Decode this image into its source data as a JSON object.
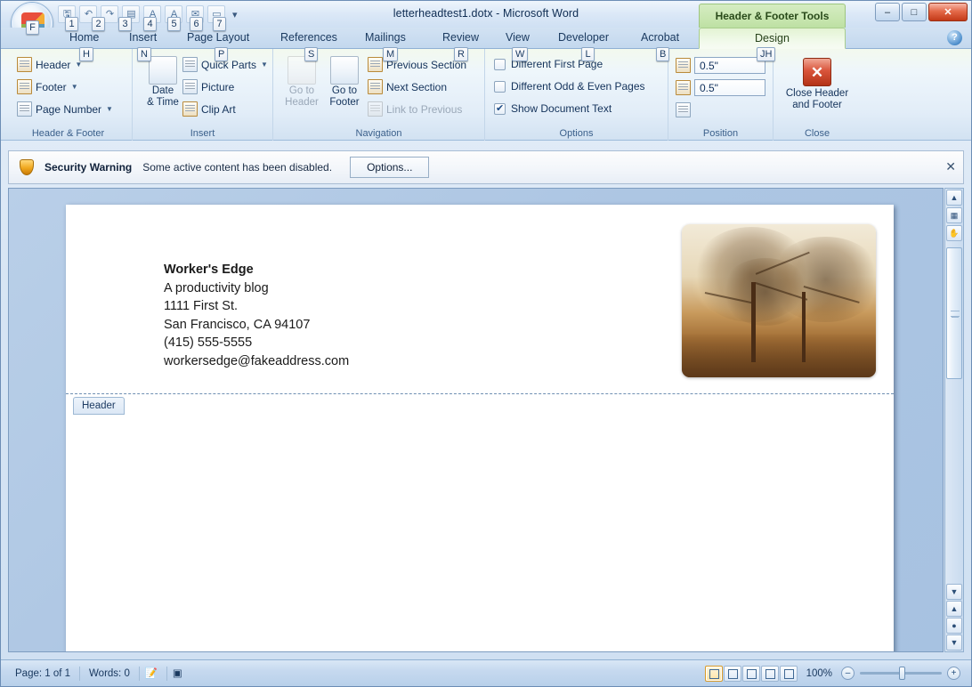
{
  "window": {
    "title": "letterheadtest1.dotx - Microsoft Word",
    "contextual_tab_title": "Header & Footer Tools",
    "minimize_label": "–",
    "maximize_label": "□",
    "close_label": "✕",
    "help_label": "?"
  },
  "office_button": {
    "keytip": "F"
  },
  "quick_access": {
    "keytips": [
      "1",
      "2",
      "3",
      "4",
      "5",
      "6",
      "7"
    ],
    "more_label": "▾"
  },
  "tabs": [
    {
      "label": "Home",
      "keytip": "H",
      "active": false
    },
    {
      "label": "Insert",
      "keytip": "N",
      "active": false
    },
    {
      "label": "Page Layout",
      "keytip": "P",
      "active": false
    },
    {
      "label": "References",
      "keytip": "S",
      "active": false
    },
    {
      "label": "Mailings",
      "keytip": "M",
      "active": false
    },
    {
      "label": "Review",
      "keytip": "R",
      "active": false
    },
    {
      "label": "View",
      "keytip": "W",
      "active": false
    },
    {
      "label": "Developer",
      "keytip": "L",
      "active": false
    },
    {
      "label": "Acrobat",
      "keytip": "B",
      "active": false
    },
    {
      "label": "Design",
      "keytip": "JH",
      "active": true
    }
  ],
  "ribbon": {
    "groups": [
      {
        "name": "Header & Footer"
      },
      {
        "name": "Insert"
      },
      {
        "name": "Navigation"
      },
      {
        "name": "Options"
      },
      {
        "name": "Position"
      },
      {
        "name": "Close"
      }
    ],
    "header_footer": {
      "header": "Header",
      "footer": "Footer",
      "page_number": "Page Number"
    },
    "insert": {
      "date_time_line1": "Date",
      "date_time_line2": "& Time",
      "quick_parts": "Quick Parts",
      "picture": "Picture",
      "clip_art": "Clip Art"
    },
    "navigation": {
      "go_to_header_line1": "Go to",
      "go_to_header_line2": "Header",
      "go_to_footer_line1": "Go to",
      "go_to_footer_line2": "Footer",
      "previous_section": "Previous Section",
      "next_section": "Next Section",
      "link_to_previous": "Link to Previous"
    },
    "options": {
      "different_first_page": "Different First Page",
      "different_first_page_checked": false,
      "different_odd_even": "Different Odd & Even Pages",
      "different_odd_even_checked": false,
      "show_document_text": "Show Document Text",
      "show_document_text_checked": true
    },
    "position": {
      "header_from_top_value": "0.5\"",
      "footer_from_bottom_value": "0.5\"",
      "alignment_tab_label": "⇥"
    },
    "close": {
      "label_line1": "Close Header",
      "label_line2": "and Footer",
      "icon_glyph": "✕"
    }
  },
  "security_bar": {
    "title": "Security Warning",
    "message": "Some active content has been disabled.",
    "button": "Options...",
    "close": "✕"
  },
  "document": {
    "letterhead": [
      "Worker's Edge",
      "A productivity blog",
      "1111 First St.",
      "San Francisco, CA 94107",
      "(415) 555-5555",
      "workersedge@fakeaddress.com"
    ],
    "header_tag": "Header",
    "image_alt": "tree-photo"
  },
  "status_bar": {
    "page": "Page: 1 of 1",
    "words": "Words: 0",
    "proofing_icon": "proofing-icon",
    "language_icon": "language-icon",
    "zoom_level": "100%",
    "zoom_out": "–",
    "zoom_in": "+",
    "views": [
      {
        "name": "print-layout",
        "selected": true
      },
      {
        "name": "full-screen-reading",
        "selected": false
      },
      {
        "name": "web-layout",
        "selected": false
      },
      {
        "name": "outline",
        "selected": false
      },
      {
        "name": "draft",
        "selected": false
      }
    ]
  },
  "scrollbar": {
    "up_arrow": "▲",
    "down_arrow": "▼",
    "prev_page": "▲",
    "select_browse": "●",
    "next_page": "▼",
    "ruler_icon": "ruler-icon",
    "hand_icon": "hand-icon"
  }
}
